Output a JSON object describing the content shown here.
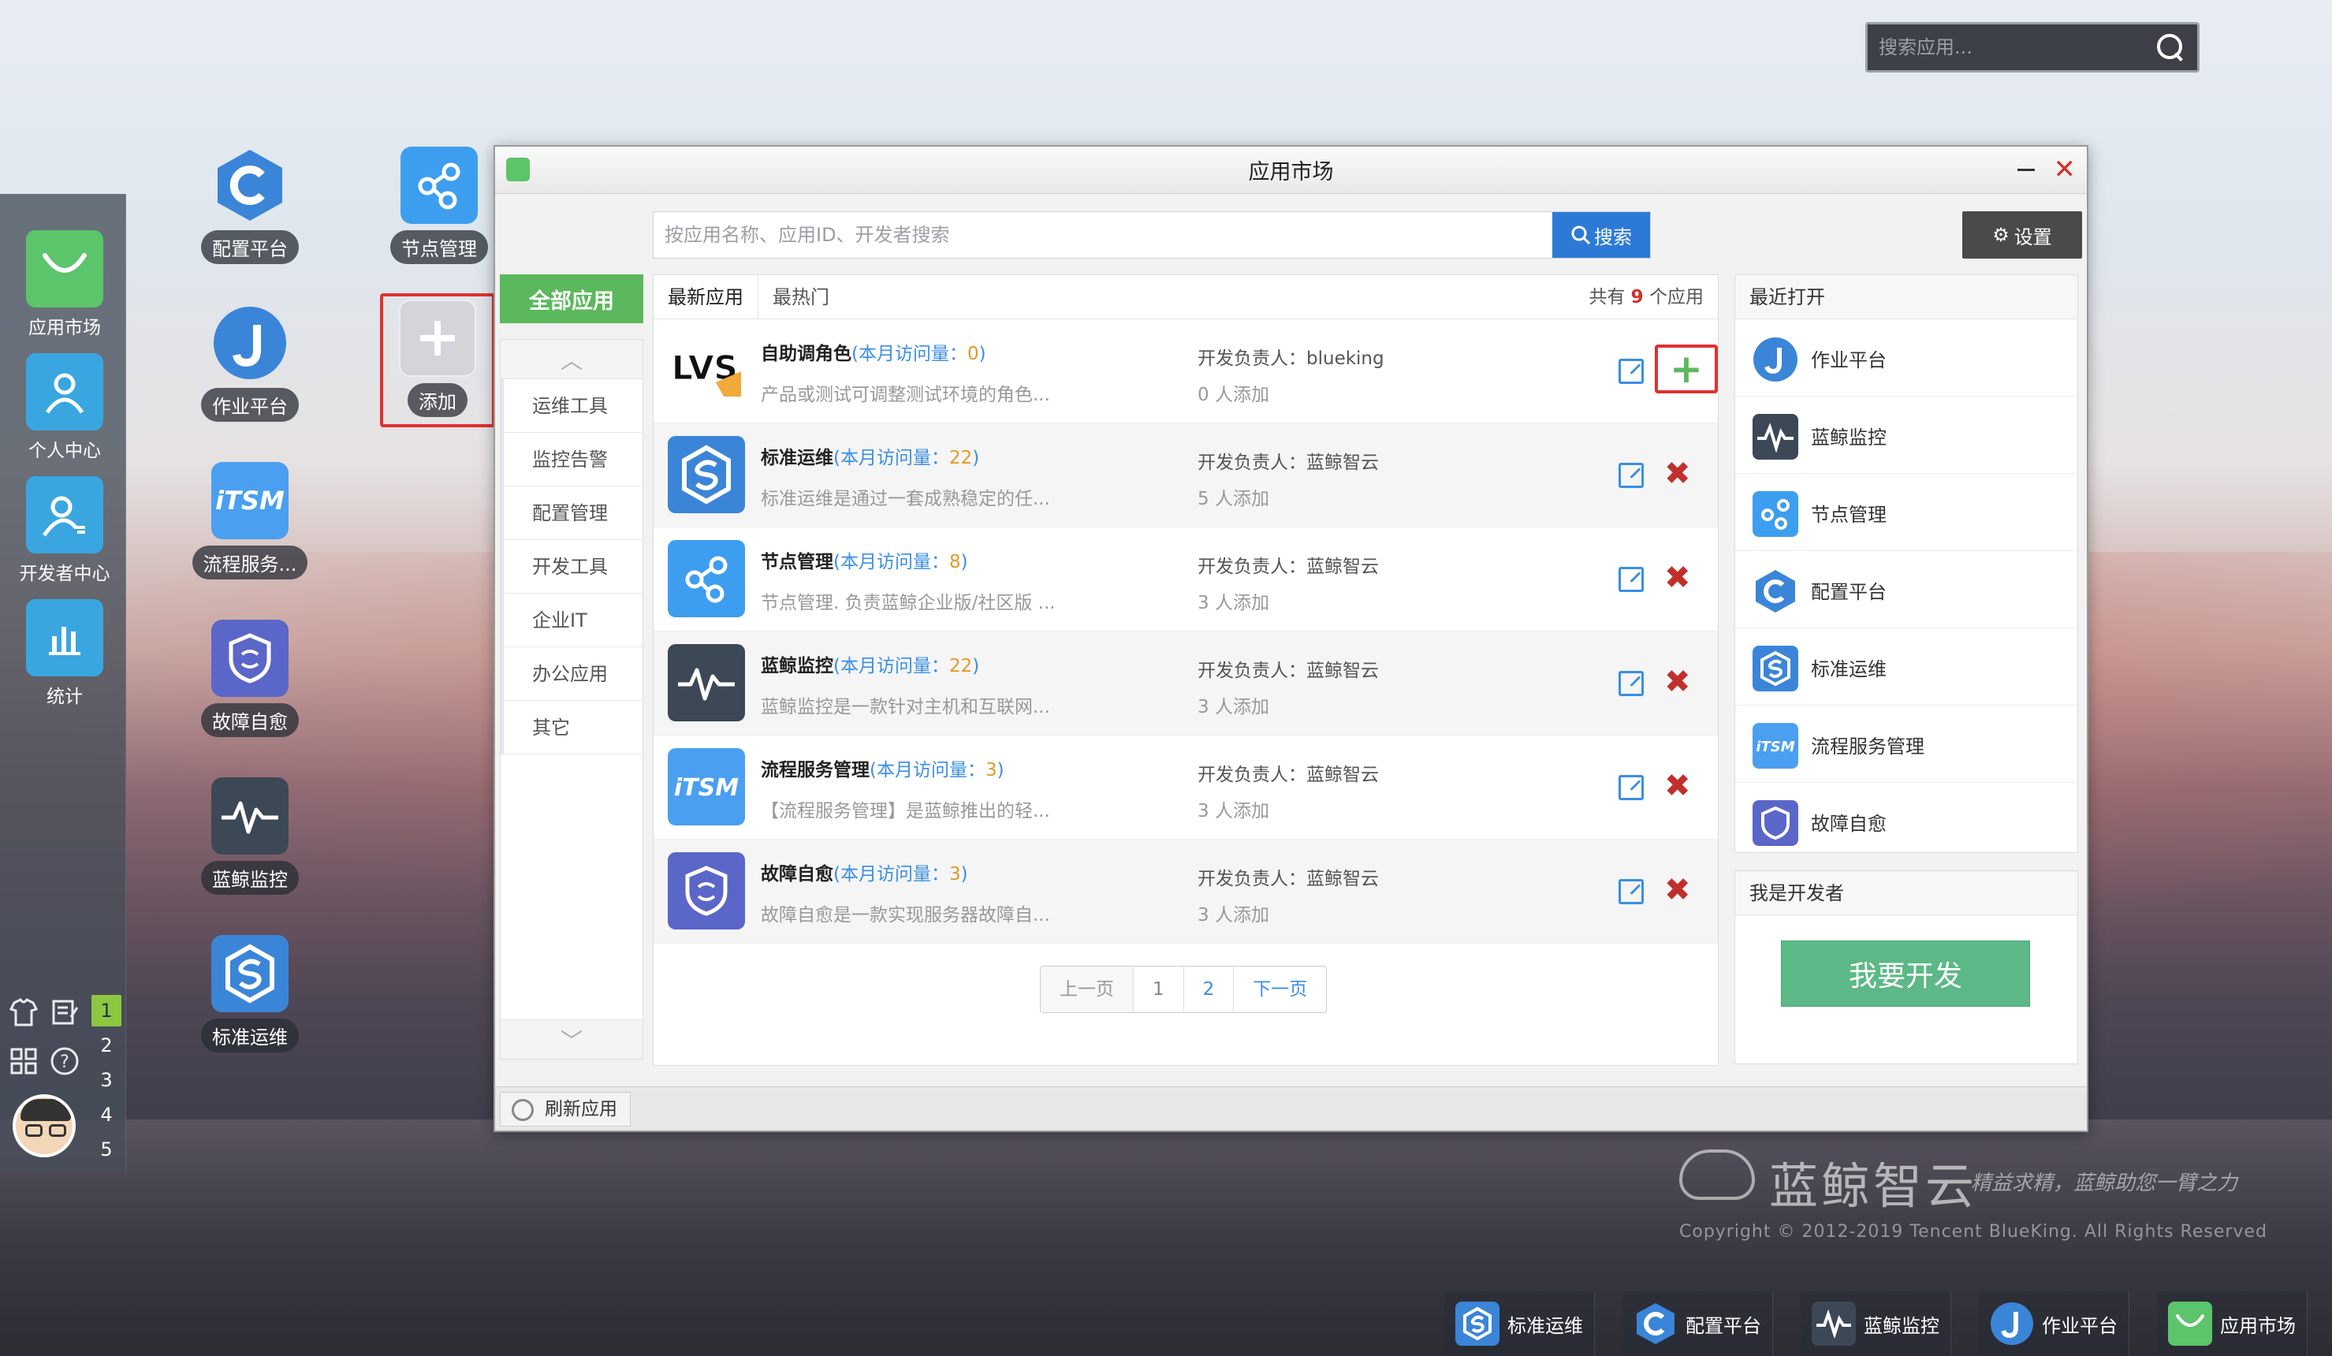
{
  "desktop": {
    "search_placeholder": "搜索应用..."
  },
  "dock": {
    "items": [
      {
        "label": "应用市场",
        "icon": "shopping-bag-icon"
      },
      {
        "label": "个人中心",
        "icon": "user-icon"
      },
      {
        "label": "开发者中心",
        "icon": "developer-icon"
      },
      {
        "label": "统计",
        "icon": "bar-chart-icon"
      }
    ],
    "workspaces": [
      "1",
      "2",
      "3",
      "4",
      "5"
    ]
  },
  "desktop_apps": [
    {
      "label": "配置平台",
      "icon": "c-logo-icon"
    },
    {
      "label": "作业平台",
      "icon": "j-logo-icon"
    },
    {
      "label": "流程服务...",
      "icon": "itsm-icon"
    },
    {
      "label": "故障自愈",
      "icon": "shield-icon"
    },
    {
      "label": "蓝鲸监控",
      "icon": "pulse-icon"
    },
    {
      "label": "标准运维",
      "icon": "gear-s-icon"
    },
    {
      "label": "节点管理",
      "icon": "node-graph-icon"
    },
    {
      "label": "添加",
      "icon": "plus-icon"
    }
  ],
  "market": {
    "title": "应用市场",
    "search_placeholder": "按应用名称、应用ID、开发者搜索",
    "search_button": "搜索",
    "settings_button": "设置",
    "categories": {
      "all": "全部应用",
      "items": [
        "运维工具",
        "监控告警",
        "配置管理",
        "开发工具",
        "企业IT",
        "办公应用",
        "其它"
      ]
    },
    "tabs": [
      "最新应用",
      "最热门"
    ],
    "count_prefix": "共有",
    "count_value": "9",
    "count_suffix": "个应用",
    "apps": [
      {
        "name": "自助调角色",
        "visits_label": "本月访问量：",
        "visits": "0",
        "desc": "产品或测试可调整测试环境的角色...",
        "owner": "开发负责人：blueking",
        "users": "0 人添加",
        "added": false,
        "logo": "lvs-logo-icon"
      },
      {
        "name": "标准运维",
        "visits_label": "本月访问量：",
        "visits": "22",
        "desc": "标准运维是通过一套成熟稳定的任...",
        "owner": "开发负责人：蓝鲸智云",
        "users": "5 人添加",
        "added": true,
        "logo": "gear-s-icon"
      },
      {
        "name": "节点管理",
        "visits_label": "本月访问量：",
        "visits": "8",
        "desc": "节点管理. 负责蓝鲸企业版/社区版 ...",
        "owner": "开发负责人：蓝鲸智云",
        "users": "3 人添加",
        "added": true,
        "logo": "node-graph-icon"
      },
      {
        "name": "蓝鲸监控",
        "visits_label": "本月访问量：",
        "visits": "22",
        "desc": "蓝鲸监控是一款针对主机和互联网...",
        "owner": "开发负责人：蓝鲸智云",
        "users": "3 人添加",
        "added": true,
        "logo": "pulse-icon"
      },
      {
        "name": "流程服务管理",
        "visits_label": "本月访问量：",
        "visits": "3",
        "desc": "【流程服务管理】是蓝鲸推出的轻...",
        "owner": "开发负责人：蓝鲸智云",
        "users": "3 人添加",
        "added": true,
        "logo": "itsm-icon"
      },
      {
        "name": "故障自愈",
        "visits_label": "本月访问量：",
        "visits": "3",
        "desc": "故障自愈是一款实现服务器故障自...",
        "owner": "开发负责人：蓝鲸智云",
        "users": "3 人添加",
        "added": true,
        "logo": "shield-icon"
      }
    ],
    "pager": {
      "prev": "上一页",
      "pages": [
        "1",
        "2"
      ],
      "next": "下一页"
    },
    "recent_title": "最近打开",
    "recent": [
      {
        "label": "作业平台",
        "icon": "j-logo-icon"
      },
      {
        "label": "蓝鲸监控",
        "icon": "pulse-icon"
      },
      {
        "label": "节点管理",
        "icon": "node-graph-icon"
      },
      {
        "label": "配置平台",
        "icon": "c-logo-icon"
      },
      {
        "label": "标准运维",
        "icon": "gear-s-icon"
      },
      {
        "label": "流程服务管理",
        "icon": "itsm-icon"
      },
      {
        "label": "故障自愈",
        "icon": "shield-icon"
      }
    ],
    "developer_title": "我是开发者",
    "developer_button": "我要开发",
    "refresh_button": "刷新应用"
  },
  "brand": {
    "name": "蓝鲸智云",
    "slogan": "精益求精，蓝鲸助您一臂之力",
    "copyright": "Copyright © 2012-2019 Tencent BlueKing. All Rights Reserved"
  },
  "taskbar": [
    {
      "label": "标准运维",
      "icon": "gear-s-icon"
    },
    {
      "label": "配置平台",
      "icon": "c-logo-icon"
    },
    {
      "label": "蓝鲸监控",
      "icon": "pulse-icon"
    },
    {
      "label": "作业平台",
      "icon": "j-logo-icon"
    },
    {
      "label": "应用市场",
      "icon": "shopping-bag-icon"
    }
  ],
  "colors": {
    "accent_blue": "#2d7ad6",
    "green": "#5cb85c",
    "danger": "#d0312d",
    "visits_num": "#e39a26"
  }
}
